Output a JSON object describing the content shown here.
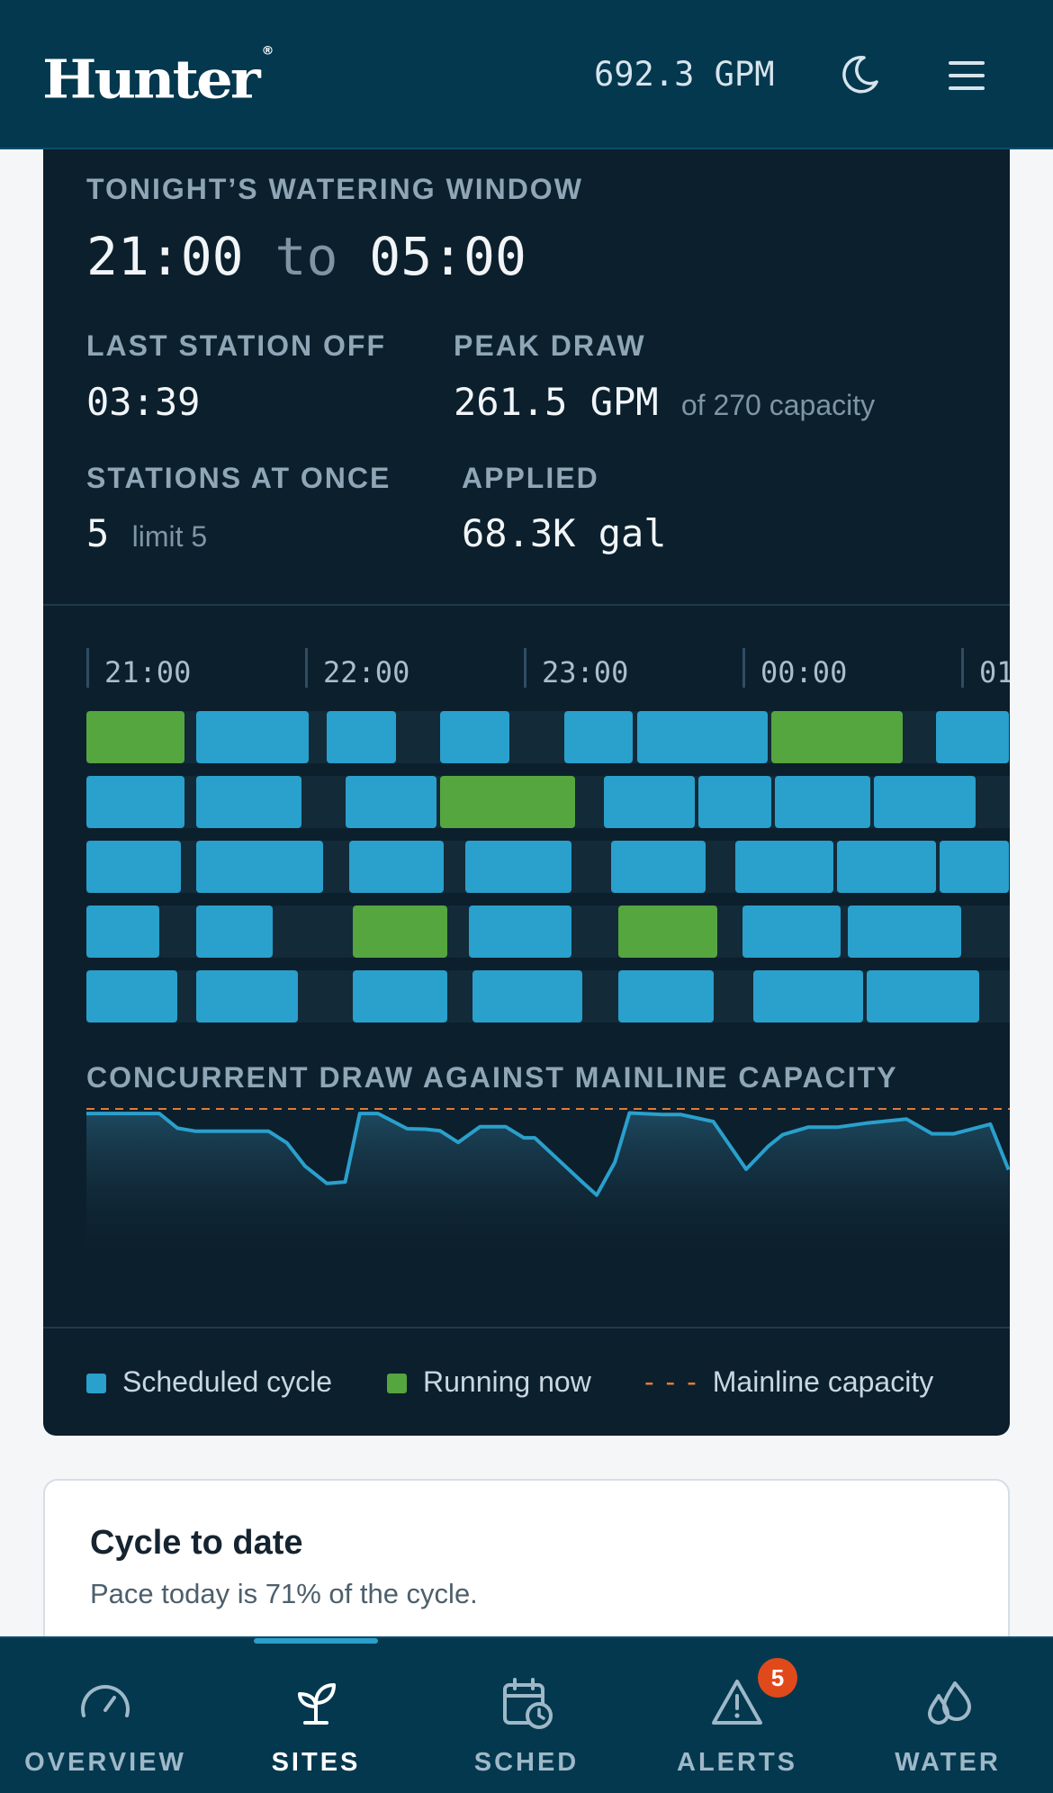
{
  "header": {
    "brand": "Hunter",
    "brand_mark": "®",
    "flow_readout": "692.3 GPM",
    "theme_icon": "moon-icon",
    "menu_icon": "hamburger-menu-icon"
  },
  "window": {
    "label": "TONIGHT’S WATERING WINDOW",
    "start": "21:00",
    "to": "to",
    "end": "05:00"
  },
  "stats": {
    "last_off": {
      "label": "LAST STATION OFF",
      "value": "03:39"
    },
    "peak_draw": {
      "label": "PEAK DRAW",
      "value": "261.5 GPM",
      "note": "of 270 capacity"
    },
    "stations": {
      "label": "STATIONS AT ONCE",
      "value": "5",
      "note": "limit 5"
    },
    "applied": {
      "label": "APPLIED",
      "value": "68.3K gal"
    }
  },
  "chart_data": [
    {
      "type": "gantt",
      "x_unit": "minutes after 21:00",
      "ticks": [
        "21:00",
        "22:00",
        "23:00",
        "00:00",
        "01:00"
      ],
      "tick_values": [
        0,
        60,
        120,
        180,
        240
      ],
      "visible_range": [
        0,
        253
      ],
      "rows": [
        [
          [
            0,
            27,
            "scheduled_run"
          ],
          [
            30,
            61,
            "scheduled"
          ],
          [
            66,
            85,
            "scheduled"
          ],
          [
            97,
            116,
            "scheduled"
          ],
          [
            131,
            150,
            "scheduled"
          ],
          [
            151,
            187,
            "scheduled"
          ],
          [
            188,
            224,
            "running"
          ],
          [
            233,
            253,
            "scheduled"
          ]
        ],
        [
          [
            0,
            27,
            "scheduled"
          ],
          [
            30,
            59,
            "scheduled"
          ],
          [
            71,
            96,
            "scheduled"
          ],
          [
            97,
            134,
            "running"
          ],
          [
            142,
            167,
            "scheduled"
          ],
          [
            168,
            188,
            "scheduled"
          ],
          [
            189,
            215,
            "scheduled"
          ],
          [
            216,
            244,
            "scheduled"
          ]
        ],
        [
          [
            0,
            26,
            "scheduled"
          ],
          [
            30,
            65,
            "scheduled"
          ],
          [
            72,
            98,
            "scheduled"
          ],
          [
            104,
            133,
            "scheduled"
          ],
          [
            144,
            170,
            "scheduled"
          ],
          [
            178,
            205,
            "scheduled"
          ],
          [
            206,
            233,
            "scheduled"
          ],
          [
            234,
            253,
            "scheduled"
          ]
        ],
        [
          [
            0,
            20,
            "scheduled"
          ],
          [
            30,
            51,
            "running_sched"
          ],
          [
            73,
            99,
            "running"
          ],
          [
            105,
            133,
            "scheduled"
          ],
          [
            146,
            173,
            "running"
          ],
          [
            180,
            207,
            "scheduled"
          ],
          [
            209,
            240,
            "scheduled"
          ]
        ],
        [
          [
            0,
            25,
            "scheduled"
          ],
          [
            30,
            58,
            "scheduled"
          ],
          [
            73,
            99,
            "scheduled"
          ],
          [
            106,
            136,
            "scheduled"
          ],
          [
            146,
            172,
            "scheduled"
          ],
          [
            183,
            213,
            "scheduled"
          ],
          [
            214,
            245,
            "scheduled"
          ]
        ]
      ]
    },
    {
      "type": "area",
      "title": "CONCURRENT DRAW AGAINST MAINLINE CAPACITY",
      "capacity": 270,
      "ylim": [
        0,
        270
      ],
      "x": [
        0,
        20,
        25,
        30,
        50,
        55,
        60,
        66,
        71,
        75,
        80,
        88,
        93,
        97,
        102,
        108,
        115,
        120,
        123,
        136,
        140,
        145,
        149,
        158,
        163,
        172,
        181,
        187,
        191,
        198,
        206,
        214,
        225,
        232,
        238,
        248,
        253
      ],
      "values": [
        261,
        261,
        232,
        226,
        226,
        203,
        157,
        123,
        126,
        261,
        261,
        231,
        230,
        227,
        204,
        235,
        235,
        213,
        213,
        126,
        100,
        165,
        262,
        259,
        259,
        245,
        151,
        196,
        219,
        234,
        234,
        242,
        250,
        221,
        221,
        240,
        150
      ]
    }
  ],
  "legend": {
    "scheduled": "Scheduled cycle",
    "running": "Running now",
    "capacity": "Mainline capacity",
    "dash_glyph": "- - -",
    "colors": {
      "scheduled": "#2aa0cc",
      "running": "#55a63f",
      "capacity": "#e07a3a"
    }
  },
  "cycle_card": {
    "title": "Cycle to date",
    "subtitle": "Pace today is 71% of the cycle."
  },
  "nav": {
    "items": [
      {
        "label": "OVERVIEW",
        "icon": "gauge-icon"
      },
      {
        "label": "SITES",
        "icon": "sprout-icon",
        "active": true
      },
      {
        "label": "SCHED",
        "icon": "calendar-clock-icon"
      },
      {
        "label": "ALERTS",
        "icon": "warning-triangle-icon",
        "badge": "5"
      },
      {
        "label": "WATER",
        "icon": "water-drops-icon"
      }
    ]
  }
}
